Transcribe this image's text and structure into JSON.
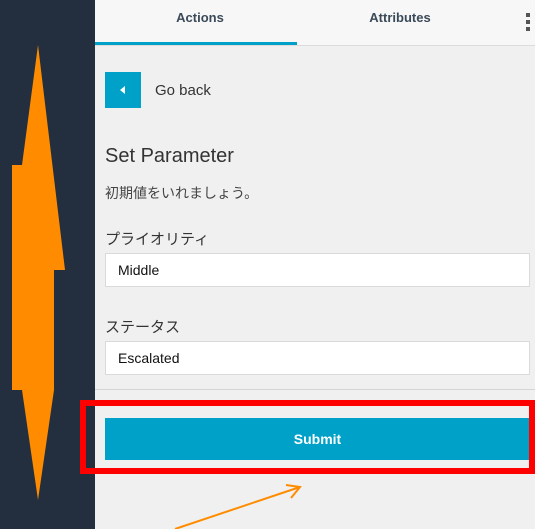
{
  "tabs": {
    "actions": "Actions",
    "attributes": "Attributes"
  },
  "nav": {
    "go_back": "Go back"
  },
  "form": {
    "title": "Set Parameter",
    "instruction": "初期値をいれましょう。",
    "priority_label": "プライオリティ",
    "priority_value": "Middle",
    "status_label": "ステータス",
    "status_value": "Escalated",
    "submit": "Submit"
  },
  "icons": {
    "back": "chevron-left-icon",
    "more": "more-vertical-icon"
  },
  "colors": {
    "accent": "#00a1c9",
    "background": "#232f3e",
    "panel": "#f0f0f0",
    "annotation_arrow": "#ff8c00",
    "highlight": "#ff0000"
  }
}
